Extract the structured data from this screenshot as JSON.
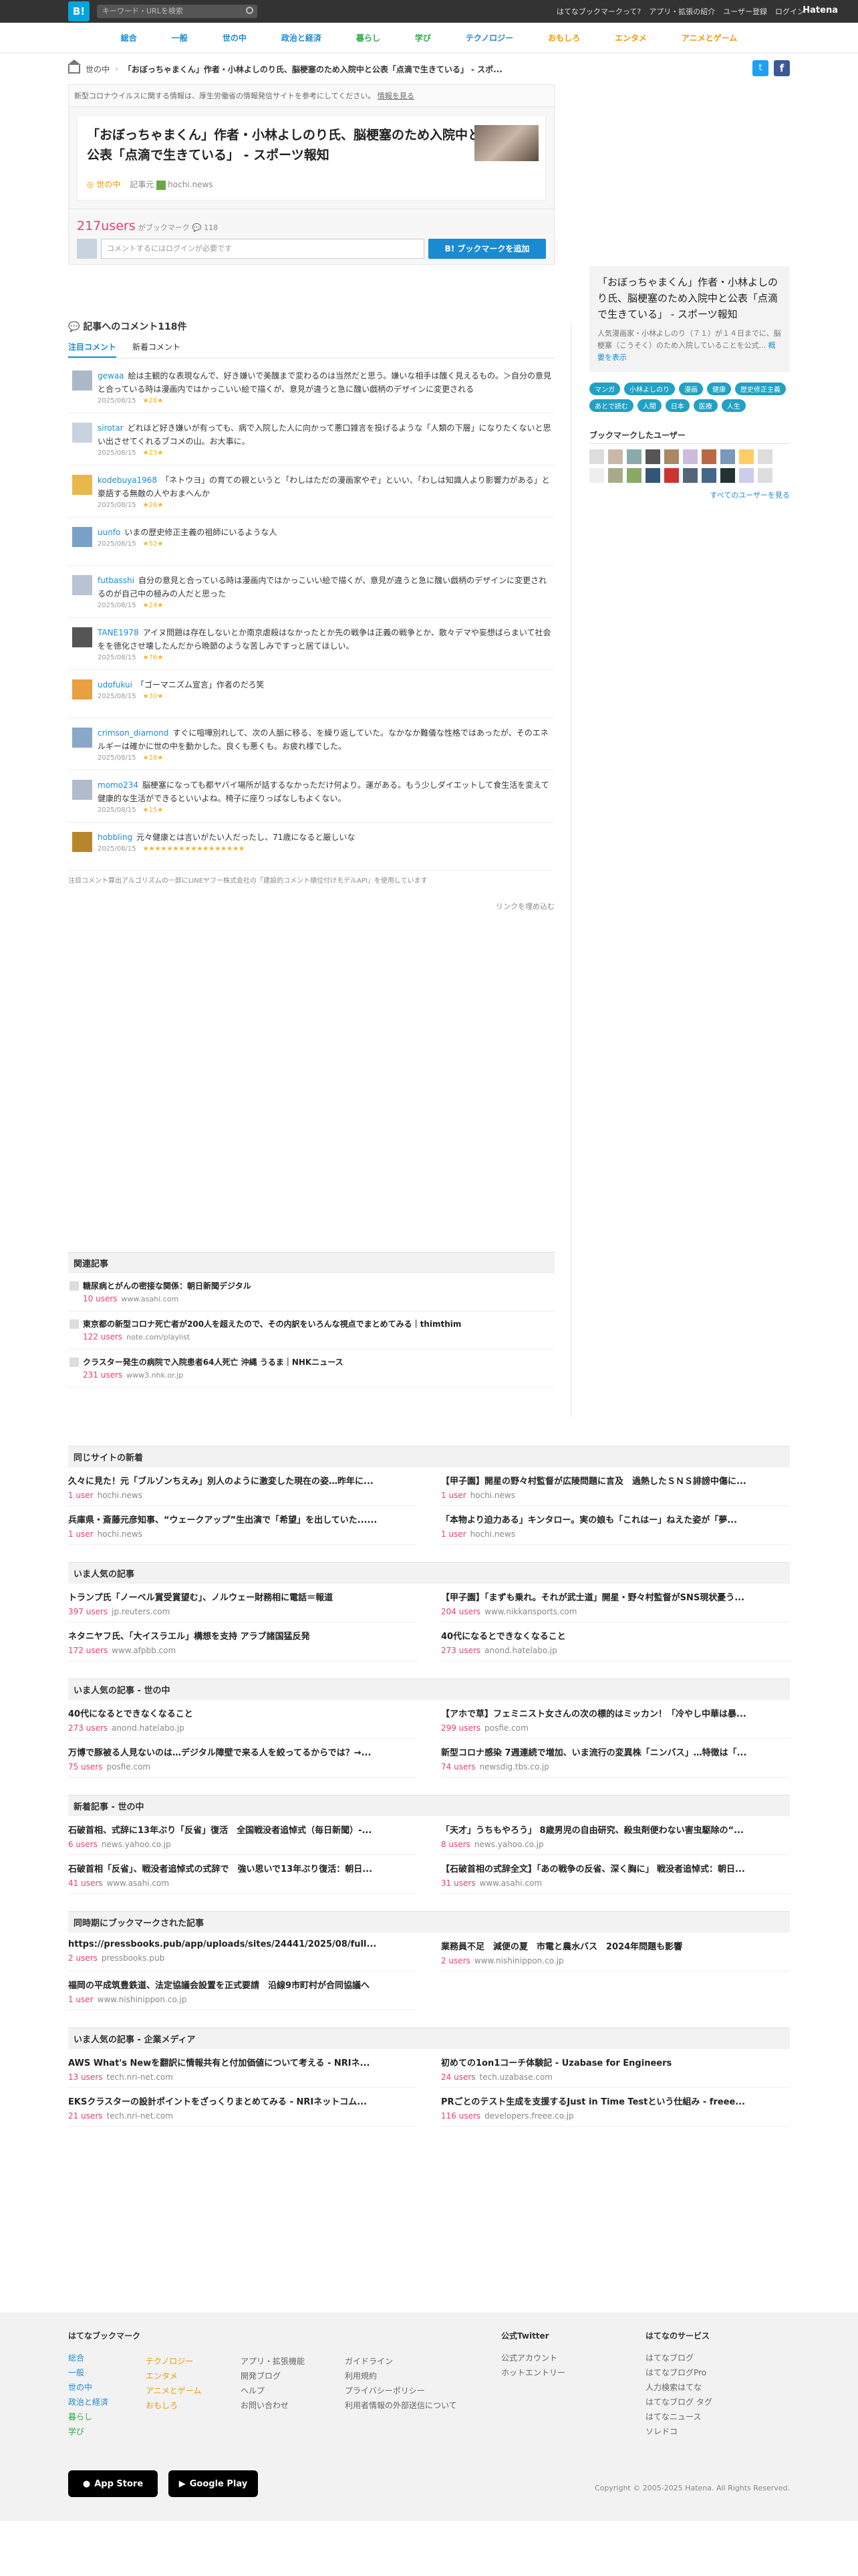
{
  "header": {
    "logo": "B!",
    "search_placeholder": "キーワード・URLを検索",
    "links": [
      "はてなブックマークって?",
      "アプリ・拡張の紹介",
      "ユーザー登録",
      "ログイン"
    ],
    "brand": "Hatena"
  },
  "nav": [
    "総合",
    "一般",
    "世の中",
    "政治と経済",
    "暮らし",
    "学び",
    "テクノロジー",
    "おもしろ",
    "エンタメ",
    "アニメとゲーム"
  ],
  "nav_colors": [
    "#1a8bd1",
    "#1a8bd1",
    "#1a8bd1",
    "#1a8bd1",
    "#2cac47",
    "#2cac47",
    "#1a8bd1",
    "#f39800",
    "#f39800",
    "#f39800"
  ],
  "breadcrumb": {
    "cat": "世の中",
    "title": "「おぼっちゃまくん」作者・小林よしのり氏、脳梗塞のため入院中と公表「点滴で生きている」 - スポ..."
  },
  "notice": "新型コロナウイルスに関する情報は、厚生労働省の情報発信サイトを参考にしてください。",
  "notice_link": "情報を見る",
  "entry": {
    "title": "「おぼっちゃまくん」作者・小林よしのり氏、脳梗塞のため入院中と公表「点滴で生きている」 - スポーツ報知",
    "category": "世の中",
    "label_source": "記事元",
    "source": "hochi.news"
  },
  "bookmark": {
    "users": "217users",
    "label": "がブックマーク",
    "comment_count": "118",
    "comment_placeholder": "コメントするにはログインが必要です",
    "add_button": "ブックマークを追加"
  },
  "comments": {
    "heading": "記事へのコメント118件",
    "tabs": [
      "注目コメント",
      "新着コメント"
    ],
    "items": [
      {
        "user": "gewaa",
        "text": "絵は主観的な表現なんで、好き嫌いで美醜まで変わるのは当然だと思う。嫌いな相手は醜く見えるもの。＞自分の意見と合っている時は漫画内ではかっこいい絵で描くが、意見が違うと急に醜い戯柄のデザインに変更される",
        "meta": "2025/08/15",
        "stars": "★28★"
      },
      {
        "user": "sirotar",
        "text": "どれほど好き嫌いが有っても、病で入院した人に向かって悪口雑言を投げるような「人類の下層」になりたくないと思い出させてくれるブコメの山。お大事に。",
        "meta": "2025/08/15",
        "stars": "★23★"
      },
      {
        "user": "kodebuya1968",
        "text": "「ネトウヨ」の育ての親というと「わしはただの漫画家やぞ」といい、「わしは知識人より影響力がある」と豪語する無敵の人やおまへんか",
        "meta": "2025/08/15",
        "stars": "★26★"
      },
      {
        "user": "uunfo",
        "text": "いまの歴史修正主義の祖師にいるような人",
        "meta": "2025/08/15",
        "stars": "★52★"
      },
      {
        "user": "futbasshi",
        "text": "自分の意見と合っている時は漫画内ではかっこいい絵で描くが、意見が違うと急に醜い戯柄のデザインに変更されるのが自己中の極みの人だと思った",
        "meta": "2025/08/15",
        "stars": "★24★"
      },
      {
        "user": "TANE1978",
        "text": "アイヌ問題は存在しないとか南京虐殺はなかったとか先の戦争は正義の戦争とか、散々デマや妄想ばらまいて社会をを徳化させ壊したんだから晩節のような苦しみですっと居てほしい。",
        "meta": "2025/08/15",
        "stars": "★76★"
      },
      {
        "user": "udofukui",
        "text": "「ゴーマニズム宣言」作者のだろ笑",
        "meta": "2025/08/15",
        "stars": "★30★"
      },
      {
        "user": "crimson_diamond",
        "text": "すぐに喧嘩別れして、次の人脈に移る、を繰り返していた。なかなか難儀な性格ではあったが、そのエネルギーは確かに世の中を動かした。良くも悪くも。お疲れ様でした。",
        "meta": "2025/08/15",
        "stars": "★28★"
      },
      {
        "user": "momo234",
        "text": "脳梗塞になっても都ヤバイ場所が話するなかっただけ何より。運がある。もう少しダイエットして食生活を変えて健康的な生活ができるといいよね。椅子に座りっぱなしもよくない。",
        "meta": "2025/08/15",
        "stars": "★15★"
      },
      {
        "user": "hobbling",
        "text": "元々健康とは言いがたい人だったし、71歳になると厳しいな",
        "meta": "2025/08/15",
        "stars": "★★★★★★★★★★★★★★★★★"
      }
    ],
    "source_note": "注目コメント算出アルゴリズムの一部にLINEヤフー株式会社の「建設的コメント順位付けモデルAPI」を使用しています",
    "more": "リンクを埋め込む"
  },
  "related": {
    "heading": "関連記事",
    "items": [
      {
        "title": "糖尿病とがんの密接な関係：朝日新聞デジタル",
        "users": "10 users",
        "site": "www.asahi.com"
      },
      {
        "title": "東京都の新型コロナ死亡者が200人を超えたので、その内訳をいろんな視点でまとめてみる｜thimthim",
        "users": "122 users",
        "site": "note.com/playlist"
      },
      {
        "title": "クラスター発生の病院で入院患者64人死亡 沖縄 うるま｜NHKニュース",
        "users": "231 users",
        "site": "www3.nhk.or.jp"
      }
    ]
  },
  "sidebar": {
    "title": "「おぼっちゃまくん」作者・小林よしのり氏、脳梗塞のため入院中と公表「点滴で生きている」 - スポーツ報知",
    "desc": "人気漫画家・小林よしのり（７１）が１４日までに、脳梗塞（こうそく）のため入院していることを公式...",
    "desc_link": "概要を表示",
    "tags": [
      "マンガ",
      "小林よしのり",
      "漫画",
      "健康",
      "歴史修正主義",
      "あとで読む",
      "人間",
      "日本",
      "医療",
      "人生"
    ],
    "bm_users_heading": "ブックマークしたユーザー",
    "all_users": "すべてのユーザーを見る"
  },
  "blocks": [
    {
      "heading": "同じサイトの新着",
      "items": [
        {
          "title": "久々に見た！元「ブルゾンちえみ」別人のように激変した現在の姿…昨年に...",
          "users": "1 user",
          "site": "hochi.news"
        },
        {
          "title": "【甲子園】開星の野々村監督が広陵問題に言及　過熱したＳＮＳ誹謗中傷に...",
          "users": "1 user",
          "site": "hochi.news"
        },
        {
          "title": "兵庫県・斎藤元彦知事、“ウェークアップ”生出演で「希望」を出していた......",
          "users": "1 user",
          "site": "hochi.news"
        },
        {
          "title": "「本物より迫力ある」キンタロー。実の娘も「これはー」ねえた姿が「夢...",
          "users": "1 user",
          "site": "hochi.news"
        }
      ]
    },
    {
      "heading": "いま人気の記事",
      "items": [
        {
          "title": "トランプ氏「ノーベル賞受賞望む」、ノルウェー財務相に電話＝報道",
          "users": "397 users",
          "site": "jp.reuters.com"
        },
        {
          "title": "【甲子園】「まずも乗れ。それが武士道」開星・野々村監督がSNS現状憂う...",
          "users": "204 users",
          "site": "www.nikkansports.com"
        },
        {
          "title": "ネタニヤフ氏、「大イスラエル」構想を支持 アラブ諸国猛反発",
          "users": "172 users",
          "site": "www.afpbb.com"
        },
        {
          "title": "40代になるとできなくなること",
          "users": "273 users",
          "site": "anond.hatelabo.jp"
        }
      ]
    },
    {
      "heading": "いま人気の記事 - 世の中",
      "items": [
        {
          "title": "40代になるとできなくなること",
          "users": "273 users",
          "site": "anond.hatelabo.jp"
        },
        {
          "title": "【アホで草】フェミニスト女さんの次の標的はミッカン！「冷やし中華は暴...",
          "users": "299 users",
          "site": "posfie.com"
        },
        {
          "title": "万博で豚被る人見ないのは…デジタル障壁で来る人を絞ってるからでは？→...",
          "users": "75 users",
          "site": "posfie.com"
        },
        {
          "title": "新型コロナ感染 7週連続で増加、いま流行の変異株「ニンバス」…特徴は「...",
          "users": "74 users",
          "site": "newsdig.tbs.co.jp"
        }
      ]
    },
    {
      "heading": "新着記事 - 世の中",
      "items": [
        {
          "title": "石破首相、式辞に13年ぶり「反省」復活　全国戦没者追悼式（毎日新聞）-...",
          "users": "6 users",
          "site": "news.yahoo.co.jp"
        },
        {
          "title": "「天才」うちもやろう」 8歳男児の自由研究、殺虫剤便わない害虫駆除の“...",
          "users": "8 users",
          "site": "news.yahoo.co.jp"
        },
        {
          "title": "石破首相「反省」、戦没者追悼式の式辞で　強い思いで13年ぶり復活：朝日...",
          "users": "41 users",
          "site": "www.asahi.com"
        },
        {
          "title": "【石破首相の式辞全文】「あの戦争の反省、深く胸に」 戦没者追悼式：朝日...",
          "users": "31 users",
          "site": "www.asahi.com"
        }
      ]
    },
    {
      "heading": "同時期にブックマークされた記事",
      "items": [
        {
          "title": "https://pressbooks.pub/app/uploads/sites/24441/2025/08/full...",
          "users": "2 users",
          "site": "pressbooks.pub"
        },
        {
          "title": "業務員不足　減便の夏　市電と農水バス　2024年問題も影響",
          "users": "2 users",
          "site": "www.nishinippon.co.jp"
        },
        {
          "title": "福岡の平成筑豊鉄道、法定協議会設置を正式要請　沿線9市町村が合同協議へ",
          "users": "1 user",
          "site": "www.nishinippon.co.jp"
        }
      ]
    },
    {
      "heading": "いま人気の記事 - 企業メディア",
      "items": [
        {
          "title": "AWS What's Newを翻訳に情報共有と付加価値について考える - NRIネ...",
          "users": "13 users",
          "site": "tech.nri-net.com"
        },
        {
          "title": "初めての1on1コーチ体験記 - Uzabase for Engineers",
          "users": "24 users",
          "site": "tech.uzabase.com"
        },
        {
          "title": "EKSクラスターの設計ポイントをざっくりまとめてみる - NRIネットコム...",
          "users": "21 users",
          "site": "tech.nri-net.com"
        },
        {
          "title": "PRごとのテスト生成を支援するJust in Time Testという仕組み - freee...",
          "users": "116 users",
          "site": "developers.freee.co.jp"
        }
      ]
    }
  ],
  "footer": {
    "bookmark_heading": "はてなブックマーク",
    "col1": [
      "総合",
      "一般",
      "世の中",
      "政治と経済",
      "暮らし",
      "学び"
    ],
    "col2": [
      "テクノロジー",
      "エンタメ",
      "アニメとゲーム",
      "おもしろ"
    ],
    "col3": [
      "アプリ・拡張機能",
      "開発ブログ",
      "ヘルプ",
      "お問い合わせ"
    ],
    "col4": [
      "ガイドライン",
      "利用規約",
      "プライバシーポリシー",
      "利用者情報の外部送信について"
    ],
    "twitter_heading": "公式Twitter",
    "col5": [
      "公式アカウント",
      "ホットエントリー"
    ],
    "services_heading": "はてなのサービス",
    "col6": [
      "はてなブログ",
      "はてなブログPro",
      "人力検索はてな",
      "はてなブログ タグ",
      "はてなニュース",
      "ソレドコ"
    ],
    "appstore": "App Store",
    "googleplay": "Google Play",
    "copyright": "Copyright © 2005-2025 Hatena. All Rights Reserved."
  }
}
